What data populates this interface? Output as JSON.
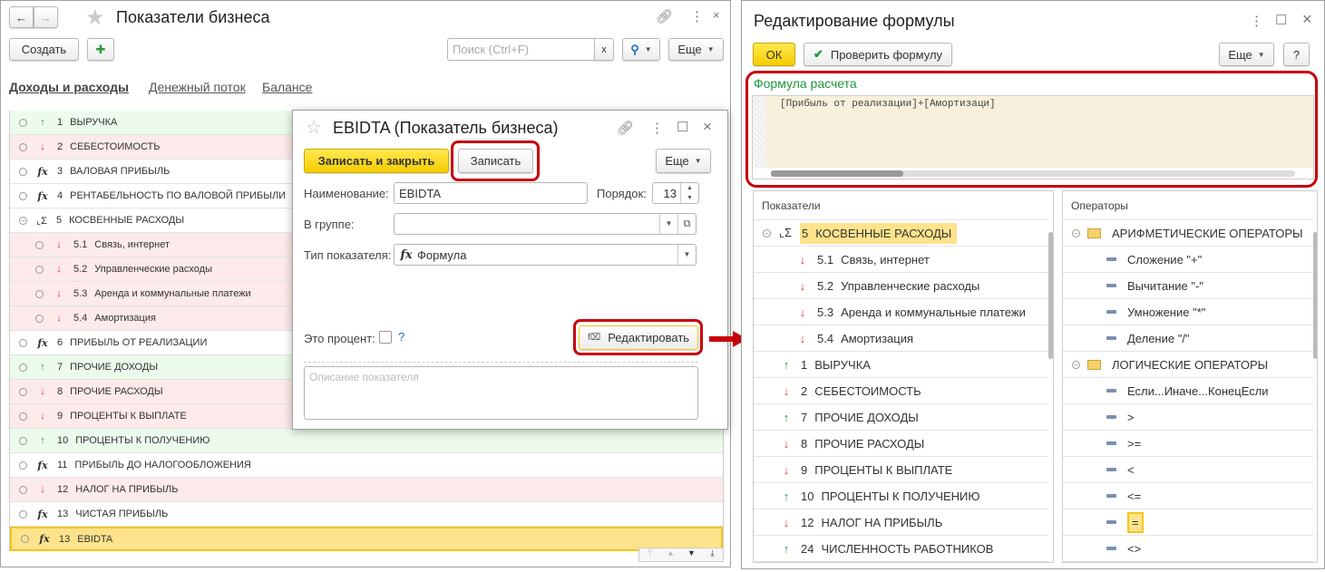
{
  "left": {
    "title": "Показатели бизнеса",
    "create_label": "Создать",
    "search_placeholder": "Поиск (Ctrl+F)",
    "search_clear": "x",
    "more_label": "Еще",
    "tabs": [
      "Доходы и расходы",
      "Денежный поток",
      "Балансе"
    ],
    "rows": [
      {
        "type": "up",
        "num": "1",
        "name": "ВЫРУЧКА"
      },
      {
        "type": "down",
        "num": "2",
        "name": "СЕБЕСТОИМОСТЬ"
      },
      {
        "type": "fx",
        "num": "3",
        "name": "ВАЛОВАЯ ПРИБЫЛЬ"
      },
      {
        "type": "fx",
        "num": "4",
        "name": "РЕНТАБЕЛЬНОСТЬ ПО ВАЛОВОЙ ПРИБЫЛИ"
      },
      {
        "type": "group",
        "num": "5",
        "name": "КОСВЕННЫЕ РАСХОДЫ"
      },
      {
        "type": "down",
        "num": "5.1",
        "name": "Связь, интернет",
        "sub": true
      },
      {
        "type": "down",
        "num": "5.2",
        "name": "Управленческие расходы",
        "sub": true
      },
      {
        "type": "down",
        "num": "5.3",
        "name": "Аренда и коммунальные платежи",
        "sub": true
      },
      {
        "type": "down",
        "num": "5.4",
        "name": "Амортизация",
        "sub": true
      },
      {
        "type": "fx",
        "num": "6",
        "name": "ПРИБЫЛЬ ОТ РЕАЛИЗАЦИИ"
      },
      {
        "type": "up",
        "num": "7",
        "name": "ПРОЧИЕ ДОХОДЫ"
      },
      {
        "type": "down",
        "num": "8",
        "name": "ПРОЧИЕ РАСХОДЫ"
      },
      {
        "type": "down",
        "num": "9",
        "name": "ПРОЦЕНТЫ К ВЫПЛАТЕ"
      },
      {
        "type": "up",
        "num": "10",
        "name": "ПРОЦЕНТЫ К ПОЛУЧЕНИЮ"
      },
      {
        "type": "fx",
        "num": "11",
        "name": "ПРИБЫЛЬ ДО НАЛОГООБЛОЖЕНИЯ"
      },
      {
        "type": "down",
        "num": "12",
        "name": "НАЛОГ НА ПРИБЫЛЬ"
      },
      {
        "type": "fx",
        "num": "13",
        "name": "ЧИСТАЯ ПРИБЫЛЬ"
      },
      {
        "type": "fx",
        "num": "13",
        "name": "EBIDTA",
        "selected": true
      }
    ]
  },
  "dialog": {
    "title": "EBIDTA (Показатель бизнеса)",
    "save_close_label": "Записать и закрыть",
    "save_label": "Записать",
    "more_label": "Еще",
    "name_label": "Наименование:",
    "name_value": "EBIDTA",
    "order_label": "Порядок:",
    "order_value": "13",
    "group_label": "В группе:",
    "group_value": "",
    "type_label": "Тип показателя:",
    "type_value": "Формула",
    "percent_label": "Это процент:",
    "percent_checked": false,
    "help": "?",
    "edit_label": "Редактировать",
    "description_placeholder": "Описание показателя"
  },
  "right": {
    "title": "Редактирование формулы",
    "ok_label": "ОК",
    "check_label": "Проверить формулу",
    "more_label": "Еще",
    "help": "?",
    "formula_label": "Формула расчета",
    "formula_value": "[Прибыль от реализации]+[Амортизаци]",
    "indicators_header": "Показатели",
    "operators_header": "Операторы",
    "indicators": [
      {
        "type": "group",
        "num": "5",
        "name": "КОСВЕННЫЕ РАСХОДЫ",
        "selected": true
      },
      {
        "type": "down",
        "num": "5.1",
        "name": "Связь, интернет",
        "sub": true
      },
      {
        "type": "down",
        "num": "5.2",
        "name": "Управленческие расходы",
        "sub": true
      },
      {
        "type": "down",
        "num": "5.3",
        "name": "Аренда и коммунальные платежи",
        "sub": true
      },
      {
        "type": "down",
        "num": "5.4",
        "name": "Амортизация",
        "sub": true
      },
      {
        "type": "up",
        "num": "1",
        "name": "ВЫРУЧКА"
      },
      {
        "type": "down",
        "num": "2",
        "name": "СЕБЕСТОИМОСТЬ"
      },
      {
        "type": "up",
        "num": "7",
        "name": "ПРОЧИЕ ДОХОДЫ"
      },
      {
        "type": "down",
        "num": "8",
        "name": "ПРОЧИЕ РАСХОДЫ"
      },
      {
        "type": "down",
        "num": "9",
        "name": "ПРОЦЕНТЫ К ВЫПЛАТЕ"
      },
      {
        "type": "up",
        "num": "10",
        "name": "ПРОЦЕНТЫ К ПОЛУЧЕНИЮ"
      },
      {
        "type": "down",
        "num": "12",
        "name": "НАЛОГ НА ПРИБЫЛЬ"
      },
      {
        "type": "up",
        "num": "24",
        "name": "ЧИСЛЕННОСТЬ РАБОТНИКОВ"
      }
    ],
    "operators": [
      {
        "type": "folder",
        "name": "АРИФМЕТИЧЕСКИЕ ОПЕРАТОРЫ"
      },
      {
        "type": "op",
        "name": "Сложение \"+\""
      },
      {
        "type": "op",
        "name": "Вычитание \"-\""
      },
      {
        "type": "op",
        "name": "Умножение \"*\""
      },
      {
        "type": "op",
        "name": "Деление \"/\""
      },
      {
        "type": "folder",
        "name": "ЛОГИЧЕСКИЕ ОПЕРАТОРЫ"
      },
      {
        "type": "op",
        "name": "Если...Иначе...КонецЕсли"
      },
      {
        "type": "op",
        "name": ">"
      },
      {
        "type": "op",
        "name": ">="
      },
      {
        "type": "op",
        "name": "<"
      },
      {
        "type": "op",
        "name": "<="
      },
      {
        "type": "op",
        "name": "=",
        "selected": true
      },
      {
        "type": "op",
        "name": "<>"
      }
    ]
  },
  "colors": {
    "accent_yellow": "#f5cc00",
    "highlight": "#c8000a",
    "formula_label": "#1a9a3a",
    "formula_bg": "#f7f0dc",
    "up": "#1a9a3a",
    "down": "#e53030"
  }
}
